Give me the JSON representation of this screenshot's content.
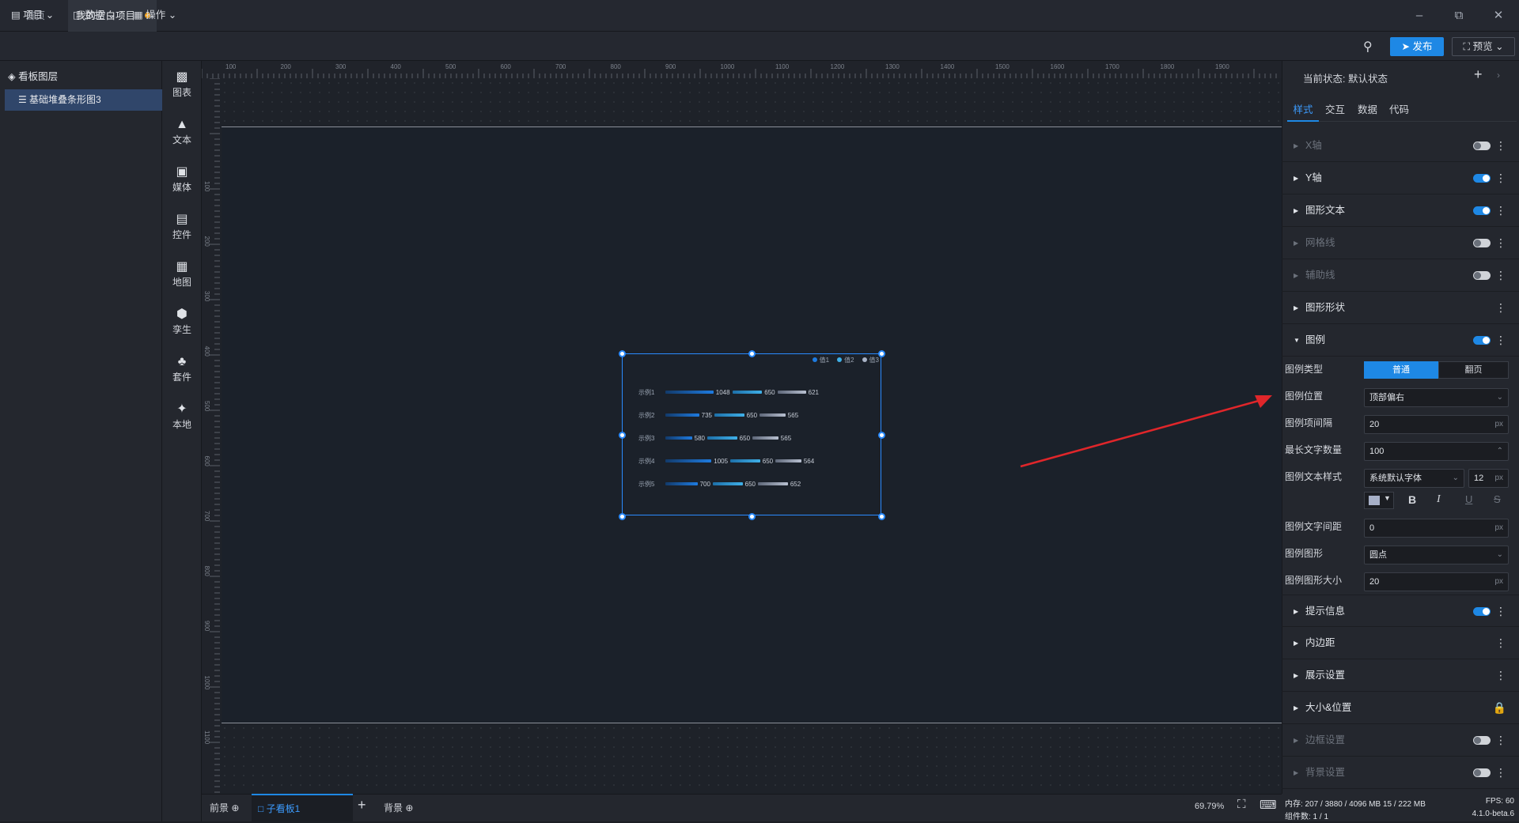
{
  "tabs": [
    {
      "label": "首页"
    },
    {
      "label": "我的空白项目"
    }
  ],
  "menu": {
    "project": "项目",
    "data": "数据",
    "operate": "操作"
  },
  "actions": {
    "publish": "发布",
    "preview": "预览"
  },
  "layers": {
    "title": "看板图层",
    "items": [
      {
        "label": "基础堆叠条形图3"
      }
    ]
  },
  "tools": [
    {
      "label": "图表"
    },
    {
      "label": "文本"
    },
    {
      "label": "媒体"
    },
    {
      "label": "控件"
    },
    {
      "label": "地图"
    },
    {
      "label": "孪生"
    },
    {
      "label": "套件"
    },
    {
      "label": "本地"
    }
  ],
  "ruler": {
    "top": [
      "100",
      "200",
      "300",
      "400",
      "500",
      "600",
      "700",
      "800",
      "900",
      "1000",
      "1100",
      "1200",
      "1300",
      "1400",
      "1500",
      "1600",
      "1700",
      "1800",
      "1900"
    ],
    "left": [
      "100",
      "200",
      "300",
      "400",
      "500",
      "600",
      "700",
      "800",
      "900",
      "1000",
      "1100"
    ]
  },
  "widget": {
    "legend": [
      "值1",
      "值2",
      "值3"
    ],
    "rows": [
      {
        "label": "示例1",
        "v1": "1048",
        "v2": "650",
        "v3": "621",
        "w1": 1048,
        "w2": 650,
        "w3": 621
      },
      {
        "label": "示例2",
        "v1": "735",
        "v2": "650",
        "v3": "565",
        "w1": 735,
        "w2": 650,
        "w3": 565
      },
      {
        "label": "示例3",
        "v1": "580",
        "v2": "650",
        "v3": "565",
        "w1": 580,
        "w2": 650,
        "w3": 565
      },
      {
        "label": "示例4",
        "v1": "1005",
        "v2": "650",
        "v3": "564",
        "w1": 1005,
        "w2": 650,
        "w3": 564
      },
      {
        "label": "示例5",
        "v1": "700",
        "v2": "650",
        "v3": "652",
        "w1": 700,
        "w2": 650,
        "w3": 652
      }
    ]
  },
  "bottom": {
    "front": "前景",
    "board": "子看板1",
    "back": "背景",
    "zoom": "69.79%"
  },
  "panel": {
    "state_label": "当前状态:",
    "state_value": "默认状态",
    "tabs": [
      "样式",
      "交互",
      "数据",
      "代码"
    ],
    "sections": {
      "xaxis": "X轴",
      "yaxis": "Y轴",
      "shape_text": "图形文本",
      "grid": "网格线",
      "aux": "辅助线",
      "shape": "图形形状",
      "legend": "图例",
      "tooltip": "提示信息",
      "padding": "内边距",
      "display": "展示设置",
      "size_pos": "大小&位置",
      "border": "边框设置",
      "background": "背景设置"
    },
    "legend_fields": {
      "type_label": "图例类型",
      "type_opt1": "普通",
      "type_opt2": "翻页",
      "pos_label": "图例位置",
      "pos_value": "顶部偏右",
      "gap_label": "图例项间隔",
      "gap_value": "20",
      "maxlen_label": "最长文字数量",
      "maxlen_value": "100",
      "style_label": "图例文本样式",
      "font_value": "系统默认字体",
      "font_size": "12",
      "textgap_label": "图例文字间距",
      "textgap_value": "0",
      "shape_label": "图例图形",
      "shape_value": "圆点",
      "shapesize_label": "图例图形大小",
      "shapesize_value": "20",
      "px": "px"
    },
    "footer": {
      "mem": "内存: 207 / 3880 / 4096 MB 15 / 222 MB",
      "fps": "FPS: 60",
      "count": "组件数: 1 / 1",
      "version": "4.1.0-beta.6"
    }
  }
}
